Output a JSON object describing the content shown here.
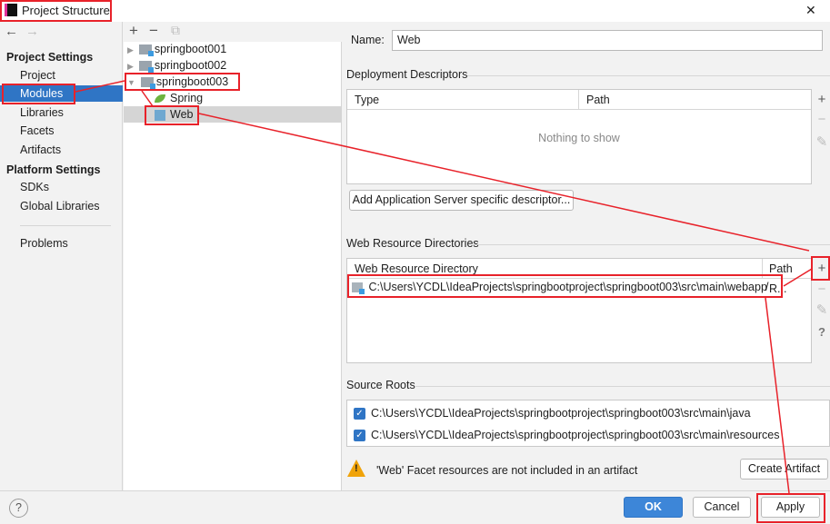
{
  "window": {
    "title": "Project Structure",
    "close": "✕"
  },
  "nav": {
    "back": "←",
    "forward": "→"
  },
  "sidebar": {
    "project_settings": "Project Settings",
    "items_ps": [
      "Project",
      "Modules",
      "Libraries",
      "Facets",
      "Artifacts"
    ],
    "platform_settings": "Platform Settings",
    "items_pl": [
      "SDKs",
      "Global Libraries"
    ],
    "problems": "Problems",
    "selected": "Modules"
  },
  "tree_toolbar": {
    "add": "+",
    "remove": "−",
    "copy": "⧉"
  },
  "tree": [
    {
      "label": "springboot001",
      "expanded": false
    },
    {
      "label": "springboot002",
      "expanded": false
    },
    {
      "label": "springboot003",
      "expanded": true
    },
    {
      "label": "Spring"
    },
    {
      "label": "Web",
      "selected": true
    }
  ],
  "name": {
    "label": "Name:",
    "value": "Web"
  },
  "deployment": {
    "title": "Deployment Descriptors",
    "col_type": "Type",
    "col_path": "Path",
    "empty": "Nothing to show",
    "add_button": "Add Application Server specific descriptor..."
  },
  "web_resources": {
    "title": "Web Resource Directories",
    "col_dir": "Web Resource Directory",
    "col_path": "Path R...",
    "rows": [
      {
        "dir": "C:\\Users\\YCDL\\IdeaProjects\\springbootproject\\springboot003\\src\\main\\webapp",
        "path": "/"
      }
    ]
  },
  "side_buttons": {
    "add": "+",
    "remove": "−",
    "edit": "✎",
    "help": "?"
  },
  "source_roots": {
    "title": "Source Roots",
    "items": [
      {
        "path": "C:\\Users\\YCDL\\IdeaProjects\\springbootproject\\springboot003\\src\\main\\java",
        "checked": true
      },
      {
        "path": "C:\\Users\\YCDL\\IdeaProjects\\springbootproject\\springboot003\\src\\main\\resources",
        "checked": true
      }
    ]
  },
  "warning": {
    "text": "'Web' Facet resources are not included in an artifact",
    "button": "Create Artifact"
  },
  "footer": {
    "help": "?",
    "ok": "OK",
    "cancel": "Cancel",
    "apply": "Apply"
  },
  "colors": {
    "accent": "#2f75c5",
    "annotation": "#e8222a"
  }
}
